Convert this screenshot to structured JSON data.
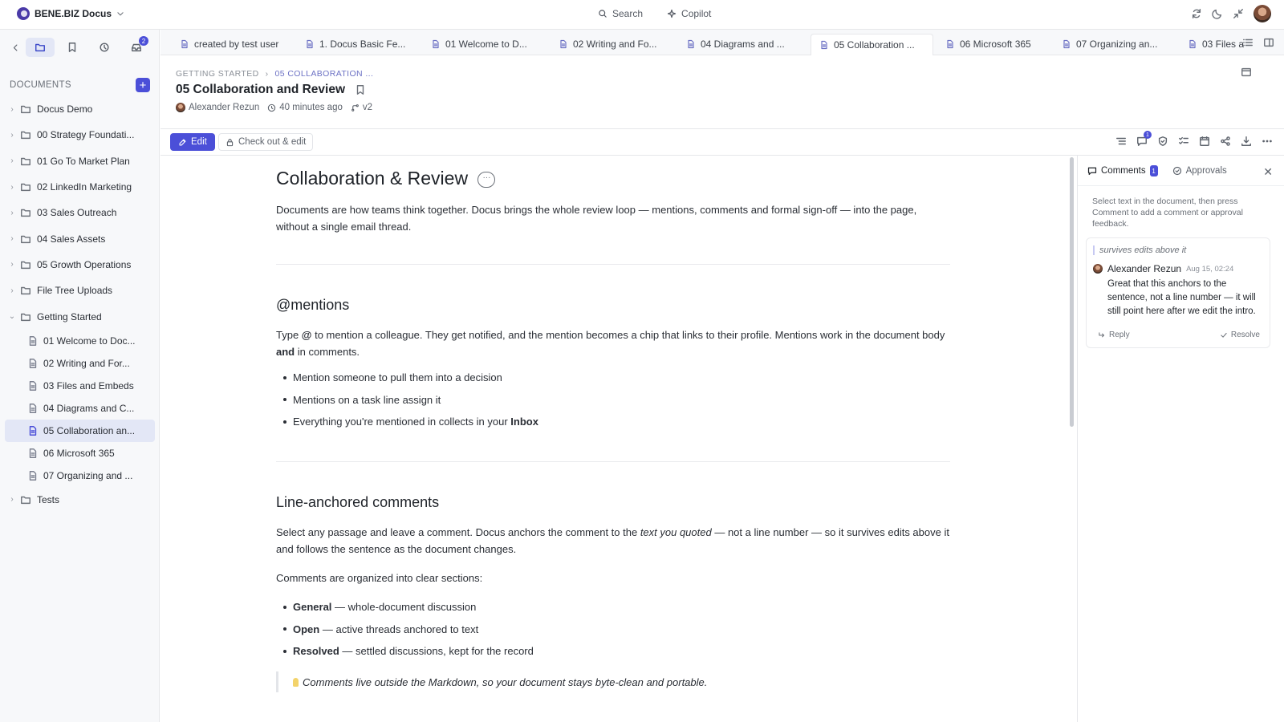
{
  "app": {
    "title": "BENE.BIZ Docus",
    "search_label": "Search",
    "copilot_label": "Copilot"
  },
  "sidebar": {
    "inbox_badge": "2",
    "section_title": "DOCUMENTS",
    "folders": [
      {
        "label": "Docus Demo"
      },
      {
        "label": "00 Strategy Foundati..."
      },
      {
        "label": "01 Go To Market Plan"
      },
      {
        "label": "02 LinkedIn Marketing"
      },
      {
        "label": "03 Sales Outreach"
      },
      {
        "label": "04 Sales Assets"
      },
      {
        "label": "05 Growth Operations"
      },
      {
        "label": "File Tree Uploads"
      },
      {
        "label": "Getting Started"
      }
    ],
    "getting_started_docs": [
      {
        "label": "01 Welcome to Doc..."
      },
      {
        "label": "02 Writing and For..."
      },
      {
        "label": "03 Files and Embeds"
      },
      {
        "label": "04 Diagrams and C..."
      },
      {
        "label": "05 Collaboration an..."
      },
      {
        "label": "06 Microsoft 365"
      },
      {
        "label": "07 Organizing and ..."
      }
    ],
    "last_folder": "Tests"
  },
  "tabs": [
    {
      "label": "created by test user"
    },
    {
      "label": "1. Docus Basic Fe..."
    },
    {
      "label": "01 Welcome to D..."
    },
    {
      "label": "02 Writing and Fo..."
    },
    {
      "label": "04 Diagrams and ..."
    },
    {
      "label": "05 Collaboration ..."
    },
    {
      "label": "06 Microsoft 365"
    },
    {
      "label": "07 Organizing an..."
    },
    {
      "label": "03 Files a"
    }
  ],
  "doc": {
    "breadcrumb_1": "GETTING STARTED",
    "breadcrumb_2": "05 COLLABORATION ...",
    "title": "05 Collaboration and Review",
    "author": "Alexander Rezun",
    "updated": "40 minutes ago",
    "version": "v2"
  },
  "toolbar": {
    "edit_label": "Edit",
    "checkout_label": "Check out & edit",
    "comments_badge": "1"
  },
  "article": {
    "h1": "Collaboration & Review",
    "intro": "Documents are how teams think together. Docus brings the whole review loop — mentions, comments and formal sign-off — into the page, without a single email thread.",
    "mentions_heading": "@mentions",
    "mentions_p_pre": "Type ",
    "mentions_p_at": "@",
    "mentions_p_mid": " to mention a colleague. They get notified, and the mention becomes a chip that links to their profile. Mentions work in the document body ",
    "mentions_p_and": "and",
    "mentions_p_post": " in comments.",
    "bullet_1": "Mention someone to pull them into a decision",
    "bullet_2": "Mentions on a task line assign it",
    "bullet_3_pre": "Everything you're mentioned in collects in your ",
    "bullet_3_bold": "Inbox",
    "line_heading": "Line-anchored comments",
    "line_p_pre": "Select any passage and leave a comment. Docus anchors the comment to the ",
    "line_p_em": "text you quoted",
    "line_p_post": " — not a line number — so it survives edits above it and follows the sentence as the document changes.",
    "sections_p": "Comments are organized into clear sections:",
    "sec_general_bold": "General",
    "sec_general_text": " — whole-document discussion",
    "sec_open_bold": "Open",
    "sec_open_text": " — active threads anchored to text",
    "sec_resolved_bold": "Resolved",
    "sec_resolved_text": " — settled discussions, kept for the record",
    "tip": "Comments live outside the Markdown, so your document stays byte-clean and portable."
  },
  "comments_panel": {
    "tab_comments": "Comments",
    "tab_comments_count": "1",
    "tab_approvals": "Approvals",
    "hint": "Select text in the document, then press Comment to add a comment or approval feedback.",
    "quote": "survives edits above it",
    "author": "Alexander Rezun",
    "date": "Aug 15, 02:24",
    "text": "Great that this anchors to the sentence, not a line number — it will still point here after we edit the intro.",
    "reply_label": "Reply",
    "resolve_label": "Resolve"
  },
  "colors": {
    "accent": "#4b4fd8",
    "selection": "#e3e7f6"
  }
}
